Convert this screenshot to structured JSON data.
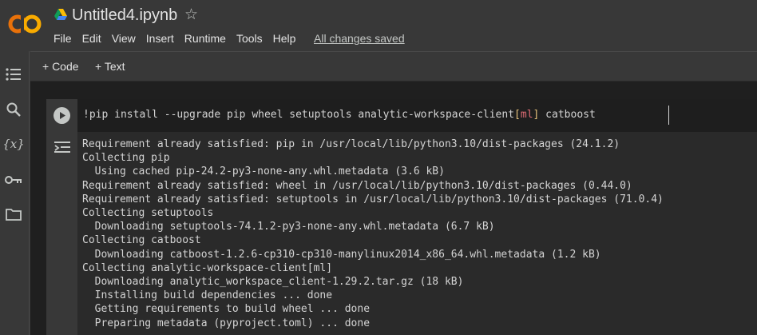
{
  "app": {
    "notebook_title": "Untitled4.ipynb",
    "logo_text": "CO",
    "save_status": "All changes saved"
  },
  "menu": [
    "File",
    "Edit",
    "View",
    "Insert",
    "Runtime",
    "Tools",
    "Help"
  ],
  "sidebar": {
    "icons": [
      "table-of-contents-icon",
      "search-icon",
      "variables-icon",
      "secrets-key-icon",
      "files-folder-icon"
    ],
    "variables_glyph": "{x}"
  },
  "toolbar": {
    "add_code_label": "+ Code",
    "add_text_label": "+ Text"
  },
  "cell": {
    "code_segments": [
      "!pip install --upgrade pip wheel setuptools analytic-workspace-client",
      "[",
      "ml",
      "]",
      " catboost"
    ],
    "output_lines": [
      "Requirement already satisfied: pip in /usr/local/lib/python3.10/dist-packages (24.1.2)",
      "Collecting pip",
      "  Using cached pip-24.2-py3-none-any.whl.metadata (3.6 kB)",
      "Requirement already satisfied: wheel in /usr/local/lib/python3.10/dist-packages (0.44.0)",
      "Requirement already satisfied: setuptools in /usr/local/lib/python3.10/dist-packages (71.0.4)",
      "Collecting setuptools",
      "  Downloading setuptools-74.1.2-py3-none-any.whl.metadata (6.7 kB)",
      "Collecting catboost",
      "  Downloading catboost-1.2.6-cp310-cp310-manylinux2014_x86_64.whl.metadata (1.2 kB)",
      "Collecting analytic-workspace-client[ml]",
      "  Downloading analytic_workspace_client-1.29.2.tar.gz (18 kB)",
      "  Installing build dependencies ... done",
      "  Getting requirements to build wheel ... done",
      "  Preparing metadata (pyproject.toml) ... done"
    ]
  },
  "colors": {
    "logo_orange": "#f9ab00",
    "logo_dark_orange": "#e8710a",
    "background": "#383838",
    "editor_bg": "#1e1e1e",
    "bracket": "#e5c07b",
    "keyword": "#e06c75"
  }
}
